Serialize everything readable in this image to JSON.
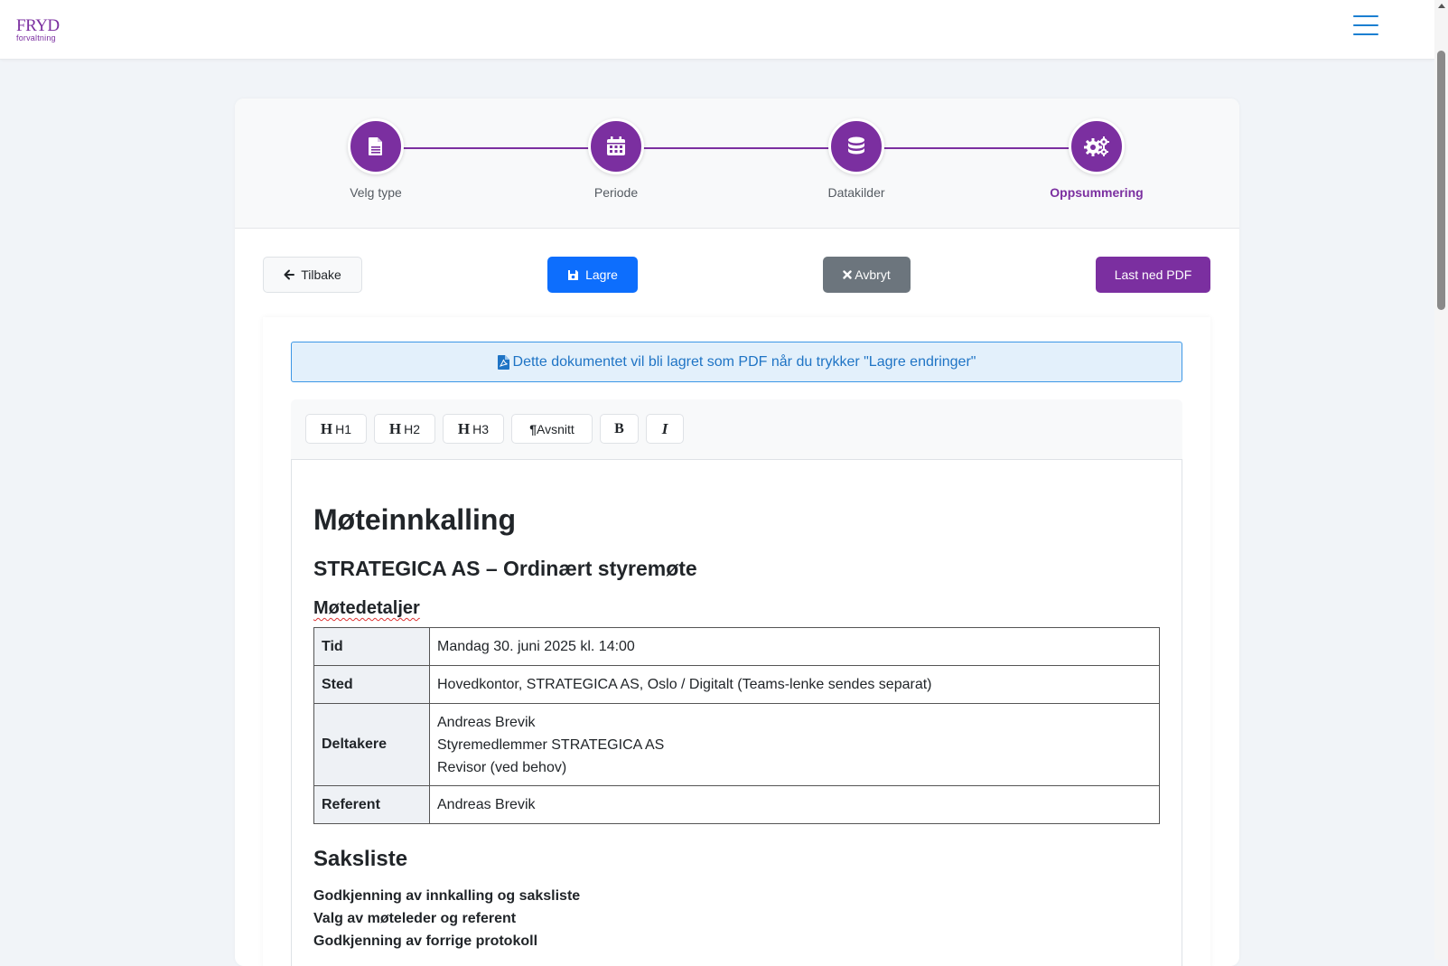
{
  "header": {
    "logo_main": "FRYD",
    "logo_sub": "forvaltning",
    "menu_icon": "hamburger-menu-icon",
    "accent_color": "#7b2fa0"
  },
  "stepper": {
    "steps": [
      {
        "label": "Velg type",
        "icon": "file-icon"
      },
      {
        "label": "Periode",
        "icon": "calendar-icon"
      },
      {
        "label": "Datakilder",
        "icon": "database-icon"
      },
      {
        "label": "Oppsummering",
        "icon": "cogs-icon",
        "active": true
      }
    ]
  },
  "actions": {
    "back_label": "Tilbake",
    "save_label": "Lagre",
    "cancel_label": "Avbryt",
    "pdf_label": "Last ned PDF"
  },
  "info_banner": {
    "text": "Dette dokumentet vil bli lagret som PDF når du trykker \"Lagre endringer\""
  },
  "toolbar": {
    "h1": "H1",
    "h2": "H2",
    "h3": "H3",
    "paragraph": "Avsnitt",
    "bold": "B",
    "italic": "I"
  },
  "document": {
    "title": "Møteinnkalling",
    "subtitle": "STRATEGICA AS – Ordinært styremøte",
    "details_heading": "Møtedetaljer",
    "details": [
      {
        "key": "Tid",
        "lines": [
          "Mandag 30. juni 2025 kl. 14:00"
        ]
      },
      {
        "key": "Sted",
        "lines": [
          "Hovedkontor, STRATEGICA AS, Oslo / Digitalt (Teams-lenke sendes separat)"
        ]
      },
      {
        "key": "Deltakere",
        "lines": [
          "Andreas Brevik",
          "Styremedlemmer STRATEGICA AS",
          "Revisor (ved behov)"
        ]
      },
      {
        "key": "Referent",
        "lines": [
          "Andreas Brevik"
        ]
      }
    ],
    "agenda_heading": "Saksliste",
    "agenda_items": [
      "Godkjenning av innkalling og saksliste",
      "Valg av møteleder og referent",
      "Godkjenning av forrige protokoll"
    ]
  }
}
